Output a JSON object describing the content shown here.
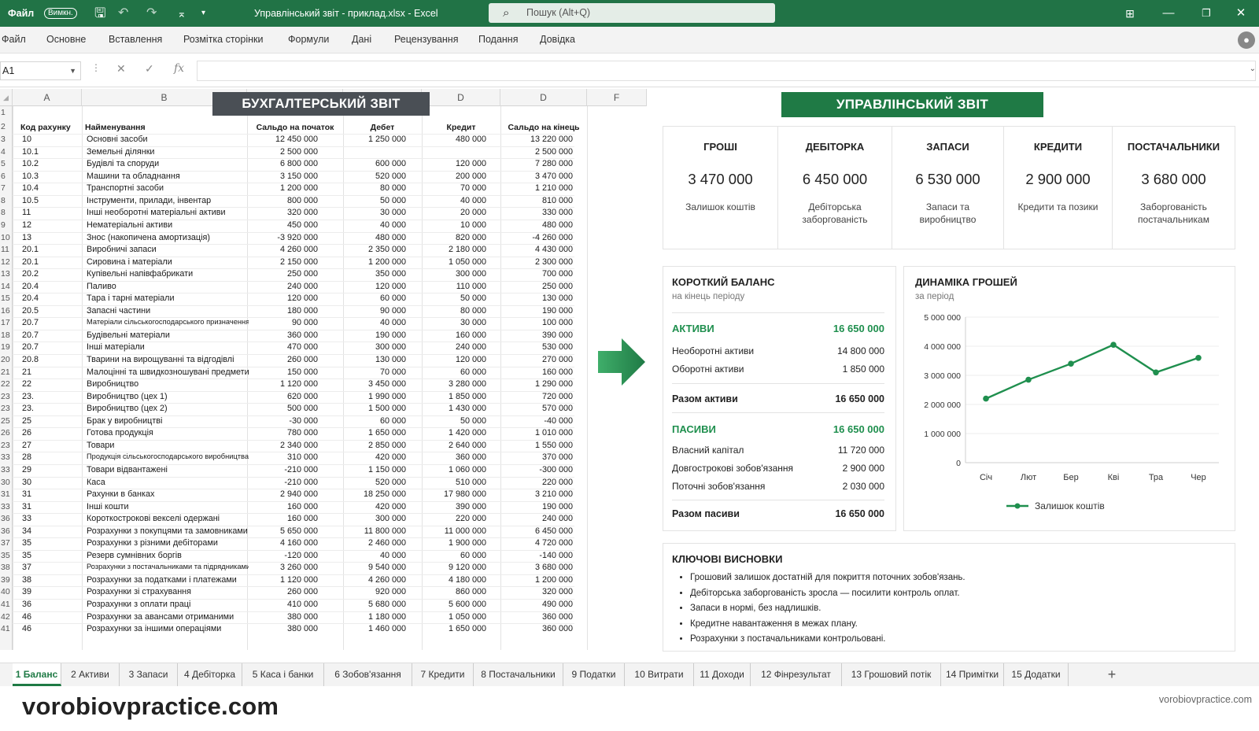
{
  "app": {
    "autosave_label": "Файл",
    "autosave_toggle": "Вимкн.",
    "window_title": "Управлінський звіт - приклад.xlsx - Excel",
    "search_placeholder": "Пошук (Alt+Q)"
  },
  "menu": [
    "Файл",
    "Основне",
    "Вставлення",
    "Розмітка сторінки",
    "Формули",
    "Дані",
    "Рецензування",
    "Подання",
    "Довідка"
  ],
  "formula_bar": {
    "name_box": "A1",
    "formula": ""
  },
  "columns": [
    "A",
    "B",
    "D",
    "D",
    "F"
  ],
  "banners": {
    "accounting": "БУХГАЛТЕРСЬКИЙ ЗВІТ",
    "management": "УПРАВЛІНСЬКИЙ ЗВІТ"
  },
  "table": {
    "headers": [
      "Код рахунку",
      "Найменування",
      "Сальдо на початок",
      "Дебет",
      "Кредит",
      "Сальдо на кінець"
    ],
    "rows": [
      {
        "n": "3",
        "code": "10",
        "name": "Основні засоби",
        "start": "12 450 000",
        "debit": "1 250 000",
        "credit": "480 000",
        "end": "13 220 000"
      },
      {
        "n": "4",
        "code": "10.1",
        "name": "Земельні ділянки",
        "start": "2 500 000",
        "debit": "",
        "credit": "",
        "end": "2 500 000"
      },
      {
        "n": "5",
        "code": "10.2",
        "name": "Будівлі та споруди",
        "start": "6 800 000",
        "debit": "600 000",
        "credit": "120 000",
        "end": "7 280 000"
      },
      {
        "n": "6",
        "code": "10.3",
        "name": "Машини та обладнання",
        "start": "3 150 000",
        "debit": "520 000",
        "credit": "200 000",
        "end": "3 470 000"
      },
      {
        "n": "7",
        "code": "10.4",
        "name": "Транспортні засоби",
        "start": "1 200 000",
        "debit": "80 000",
        "credit": "70 000",
        "end": "1 210 000"
      },
      {
        "n": "8",
        "code": "10.5",
        "name": "Інструменти, прилади, інвентар",
        "start": "800 000",
        "debit": "50 000",
        "credit": "40 000",
        "end": "810 000"
      },
      {
        "n": "8",
        "code": "11",
        "name": "Інші необоротні матеріальні активи",
        "start": "320 000",
        "debit": "30 000",
        "credit": "20 000",
        "end": "330 000"
      },
      {
        "n": "9",
        "code": "12",
        "name": "Нематеріальні активи",
        "start": "450 000",
        "debit": "40 000",
        "credit": "10 000",
        "end": "480 000"
      },
      {
        "n": "10",
        "code": "13",
        "name": "Знос (накопичена амортизація)",
        "start": "-3 920 000",
        "debit": "480 000",
        "credit": "820 000",
        "end": "-4 260 000"
      },
      {
        "n": "11",
        "code": "20.1",
        "name": "Виробничі запаси",
        "start": "4 260 000",
        "debit": "2 350 000",
        "credit": "2 180 000",
        "end": "4 430 000"
      },
      {
        "n": "12",
        "code": "20.1",
        "name": "Сировина і матеріали",
        "start": "2 150 000",
        "debit": "1 200 000",
        "credit": "1 050 000",
        "end": "2 300 000"
      },
      {
        "n": "13",
        "code": "20.2",
        "name": "Купівельні напівфабрикати",
        "start": "250 000",
        "debit": "350 000",
        "credit": "300 000",
        "end": "700 000"
      },
      {
        "n": "14",
        "code": "20.4",
        "name": "Паливо",
        "start": "240 000",
        "debit": "120 000",
        "credit": "110 000",
        "end": "250 000"
      },
      {
        "n": "15",
        "code": "20.4",
        "name": "Тара і тарні матеріали",
        "start": "120 000",
        "debit": "60 000",
        "credit": "50 000",
        "end": "130 000"
      },
      {
        "n": "16",
        "code": "20.5",
        "name": "Запасні частини",
        "start": "180 000",
        "debit": "90 000",
        "credit": "80 000",
        "end": "190 000"
      },
      {
        "n": "17",
        "code": "20.7",
        "name": "Матеріали сільськогосподарського призначення",
        "start": "90 000",
        "debit": "40 000",
        "credit": "30 000",
        "end": "100 000"
      },
      {
        "n": "18",
        "code": "20.7",
        "name": "Будівельні матеріали",
        "start": "360 000",
        "debit": "190 000",
        "credit": "160 000",
        "end": "390 000"
      },
      {
        "n": "19",
        "code": "20.7",
        "name": "Інші матеріали",
        "start": "470 000",
        "debit": "300 000",
        "credit": "240 000",
        "end": "530 000"
      },
      {
        "n": "20",
        "code": "20.8",
        "name": "Тварини на вирощуванні та відгодівлі",
        "start": "260 000",
        "debit": "130 000",
        "credit": "120 000",
        "end": "270 000"
      },
      {
        "n": "21",
        "code": "21",
        "name": "Малоцінні та швидкозношувані предмети",
        "start": "150 000",
        "debit": "70 000",
        "credit": "60 000",
        "end": "160 000"
      },
      {
        "n": "22",
        "code": "22",
        "name": "Виробництво",
        "start": "1 120 000",
        "debit": "3 450 000",
        "credit": "3 280 000",
        "end": "1 290 000"
      },
      {
        "n": "23",
        "code": "23.",
        "name": "Виробництво (цех 1)",
        "start": "620 000",
        "debit": "1 990 000",
        "credit": "1 850 000",
        "end": "720 000"
      },
      {
        "n": "23",
        "code": "23.",
        "name": "Виробництво (цех 2)",
        "start": "500 000",
        "debit": "1 500 000",
        "credit": "1 430 000",
        "end": "570 000"
      },
      {
        "n": "25",
        "code": "25",
        "name": "Брак у виробництві",
        "start": "-30 000",
        "debit": "60 000",
        "credit": "50 000",
        "end": "-40 000"
      },
      {
        "n": "26",
        "code": "26",
        "name": "Готова продукція",
        "start": "780 000",
        "debit": "1 650 000",
        "credit": "1 420 000",
        "end": "1 010 000"
      },
      {
        "n": "23",
        "code": "27",
        "name": "Товари",
        "start": "2 340 000",
        "debit": "2 850 000",
        "credit": "2 640 000",
        "end": "1 550 000"
      },
      {
        "n": "33",
        "code": "28",
        "name": "Продукція сільськогосподарського виробництва",
        "start": "310 000",
        "debit": "420 000",
        "credit": "360 000",
        "end": "370 000"
      },
      {
        "n": "33",
        "code": "29",
        "name": "Товари відвантажені",
        "start": "-210 000",
        "debit": "1 150 000",
        "credit": "1 060 000",
        "end": "-300 000"
      },
      {
        "n": "30",
        "code": "30",
        "name": "Каса",
        "start": "-210 000",
        "debit": "520 000",
        "credit": "510 000",
        "end": "220 000"
      },
      {
        "n": "31",
        "code": "31",
        "name": "Рахунки в банках",
        "start": "2 940 000",
        "debit": "18 250 000",
        "credit": "17 980 000",
        "end": "3 210 000"
      },
      {
        "n": "33",
        "code": "31",
        "name": "Інші кошти",
        "start": "160 000",
        "debit": "420 000",
        "credit": "390 000",
        "end": "190 000"
      },
      {
        "n": "36",
        "code": "33",
        "name": "Короткострокові векселі одержані",
        "start": "160 000",
        "debit": "300 000",
        "credit": "220 000",
        "end": "240 000"
      },
      {
        "n": "36",
        "code": "34",
        "name": "Розрахунки з покупцями та замовниками",
        "start": "5 650 000",
        "debit": "11 800 000",
        "credit": "11 000 000",
        "end": "6 450 000"
      },
      {
        "n": "37",
        "code": "35",
        "name": "Розрахунки з різними дебіторами",
        "start": "4 160 000",
        "debit": "2 460 000",
        "credit": "1 900 000",
        "end": "4 720 000"
      },
      {
        "n": "35",
        "code": "35",
        "name": "Резерв сумнівних боргів",
        "start": "-120 000",
        "debit": "40 000",
        "credit": "60 000",
        "end": "-140 000"
      },
      {
        "n": "38",
        "code": "37",
        "name": "Розрахунки з постачальниками та підрядниками",
        "start": "3 260 000",
        "debit": "9 540 000",
        "credit": "9 120 000",
        "end": "3 680 000"
      },
      {
        "n": "39",
        "code": "38",
        "name": "Розрахунки за податками і платежами",
        "start": "1 120 000",
        "debit": "4 260 000",
        "credit": "4 180 000",
        "end": "1 200 000"
      },
      {
        "n": "40",
        "code": "39",
        "name": "Розрахунки зі страхування",
        "start": "260 000",
        "debit": "920 000",
        "credit": "860 000",
        "end": "320 000"
      },
      {
        "n": "41",
        "code": "36",
        "name": "Розрахунки з оплати праці",
        "start": "410 000",
        "debit": "5 680 000",
        "credit": "5 600 000",
        "end": "490 000"
      },
      {
        "n": "42",
        "code": "46",
        "name": "Розрахунки за авансами отриманими",
        "start": "380 000",
        "debit": "1 180 000",
        "credit": "1 050 000",
        "end": "360 000"
      },
      {
        "n": "41",
        "code": "46",
        "name": "Розрахунки за іншими операціями",
        "start": "380 000",
        "debit": "1 460 000",
        "credit": "1 650 000",
        "end": "360 000"
      }
    ]
  },
  "kpis": [
    {
      "title": "ГРОШІ",
      "value": "3 470 000",
      "sub": "Залишок коштів"
    },
    {
      "title": "ДЕБІТОРКА",
      "value": "6 450 000",
      "sub": "Дебіторська заборгованість"
    },
    {
      "title": "ЗАПАСИ",
      "value": "6 530 000",
      "sub": "Запаси та виробництво"
    },
    {
      "title": "КРЕДИТИ",
      "value": "2 900 000",
      "sub": "Кредити та позики"
    },
    {
      "title": "ПОСТАЧАЛЬНИКИ",
      "value": "3 680 000",
      "sub": "Заборгованість постачальникам"
    }
  ],
  "balance": {
    "title": "КОРОТКИЙ БАЛАНС",
    "subtitle": "на кінець періоду",
    "assets_label": "АКТИВИ",
    "assets_value": "16 650 000",
    "noncurrent_label": "Необоротні активи",
    "noncurrent_value": "14 800 000",
    "current_label": "Оборотні активи",
    "current_value": "1 850 000",
    "total_assets_label": "Разом активи",
    "total_assets_value": "16 650 000",
    "liab_label": "ПАСИВИ",
    "liab_value": "16 650 000",
    "equity_label": "Власний капітал",
    "equity_value": "11 720 000",
    "longterm_label": "Довгострокові зобов'язання",
    "longterm_value": "2 900 000",
    "shortterm_label": "Поточні зобов'язання",
    "shortterm_value": "2 030 000",
    "total_liab_label": "Разом пасиви",
    "total_liab_value": "16 650 000"
  },
  "chart_data": {
    "type": "line",
    "title": "ДИНАМІКА ГРОШЕЙ",
    "subtitle": "за період",
    "categories": [
      "Січ",
      "Лют",
      "Бер",
      "Кві",
      "Тра",
      "Чер"
    ],
    "series": [
      {
        "name": "Залишок коштів",
        "values": [
          2200000,
          2850000,
          3400000,
          4050000,
          3100000,
          3600000
        ],
        "color": "#1f8f4e"
      }
    ],
    "ylim": [
      0,
      5000000
    ],
    "yticks": [
      {
        "v": 0,
        "label": "0"
      },
      {
        "v": 1000000,
        "label": "1 000 000"
      },
      {
        "v": 2000000,
        "label": "2 000 000"
      },
      {
        "v": 3000000,
        "label": "3 000 000"
      },
      {
        "v": 4000000,
        "label": "4 000 000"
      },
      {
        "v": 5000000,
        "label": "5 000 000"
      }
    ],
    "grid": true,
    "legend": "bottom"
  },
  "conclusions": {
    "title": "КЛЮЧОВІ ВИСНОВКИ",
    "items": [
      "Грошовий залишок достатній для покриття поточних зобов'язань.",
      "Дебіторська заборгованість зросла — посилити контроль оплат.",
      "Запаси в нормі, без надлишків.",
      "Кредитне навантаження в межах плану.",
      "Розрахунки з постачальниками контрольовані."
    ]
  },
  "sheet_tabs": [
    "1 Баланс",
    "2 Активи",
    "3 Запаси",
    "4 Дебіторка",
    "5 Каса і банки",
    "6 Зобов'язання",
    "7 Кредити",
    "8 Постачальники",
    "9 Податки",
    "10 Витрати",
    "11 Доходи",
    "12 Фінрезультат",
    "13 Грошовий потік",
    "14 Примітки",
    "15 Додатки"
  ],
  "active_tab": 0,
  "add_tab": "+",
  "watermark_big": "vorobiovpractice.com",
  "watermark_small": "vorobiovpractice.com",
  "colors": {
    "excel_green": "#217346",
    "accent": "#1f8f4e",
    "banner_dark": "#4a4f55"
  }
}
